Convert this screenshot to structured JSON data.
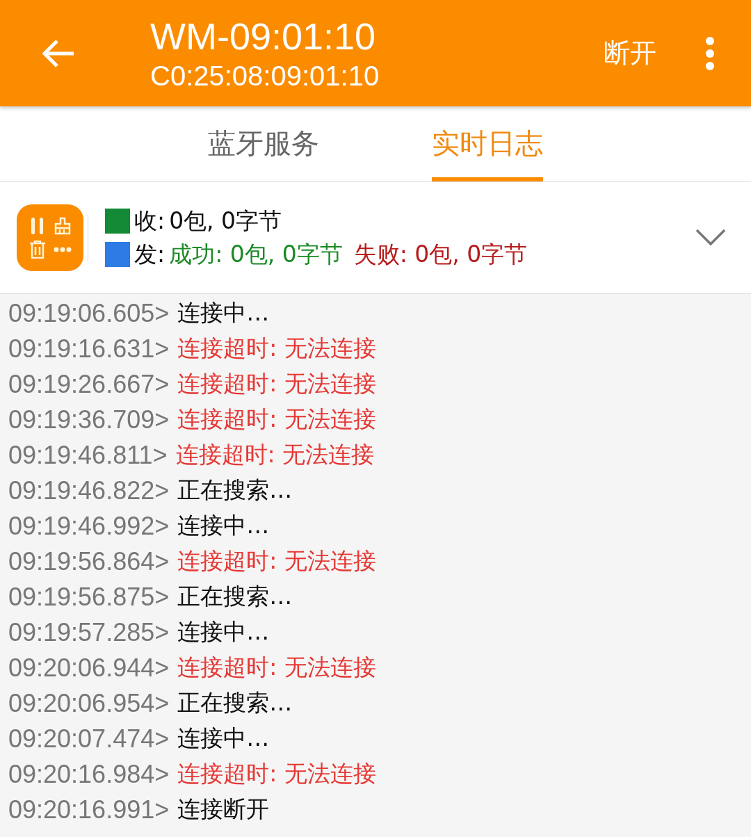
{
  "app_bar": {
    "title": "WM-09:01:10",
    "subtitle": "C0:25:08:09:01:10",
    "action": "断开"
  },
  "tabs": [
    {
      "label": "蓝牙服务",
      "selected": false
    },
    {
      "label": "实时日志",
      "selected": true
    }
  ],
  "stats": [
    {
      "color": "#138a36",
      "label": "收:",
      "parts": [
        {
          "kind": "plain",
          "text": "0包, 0字节"
        }
      ]
    },
    {
      "color": "#2f7be6",
      "label": "发:",
      "parts": [
        {
          "kind": "success",
          "text": "成功: 0包, 0字节"
        },
        {
          "kind": "failure",
          "text": "失败: 0包, 0字节"
        }
      ]
    }
  ],
  "log": [
    {
      "time": "09:19:06.605>",
      "message": "连接中…",
      "kind": "info"
    },
    {
      "time": "09:19:16.631>",
      "message": "连接超时: 无法连接",
      "kind": "error"
    },
    {
      "time": "09:19:26.667>",
      "message": "连接超时: 无法连接",
      "kind": "error"
    },
    {
      "time": "09:19:36.709>",
      "message": "连接超时: 无法连接",
      "kind": "error"
    },
    {
      "time": "09:19:46.811>",
      "message": "连接超时: 无法连接",
      "kind": "error"
    },
    {
      "time": "09:19:46.822>",
      "message": "正在搜索…",
      "kind": "info"
    },
    {
      "time": "09:19:46.992>",
      "message": "连接中…",
      "kind": "info"
    },
    {
      "time": "09:19:56.864>",
      "message": "连接超时: 无法连接",
      "kind": "error"
    },
    {
      "time": "09:19:56.875>",
      "message": "正在搜索…",
      "kind": "info"
    },
    {
      "time": "09:19:57.285>",
      "message": "连接中…",
      "kind": "info"
    },
    {
      "time": "09:20:06.944>",
      "message": "连接超时: 无法连接",
      "kind": "error"
    },
    {
      "time": "09:20:06.954>",
      "message": "正在搜索…",
      "kind": "info"
    },
    {
      "time": "09:20:07.474>",
      "message": "连接中…",
      "kind": "info"
    },
    {
      "time": "09:20:16.984>",
      "message": "连接超时: 无法连接",
      "kind": "error"
    },
    {
      "time": "09:20:16.991>",
      "message": "连接断开",
      "kind": "info"
    }
  ]
}
